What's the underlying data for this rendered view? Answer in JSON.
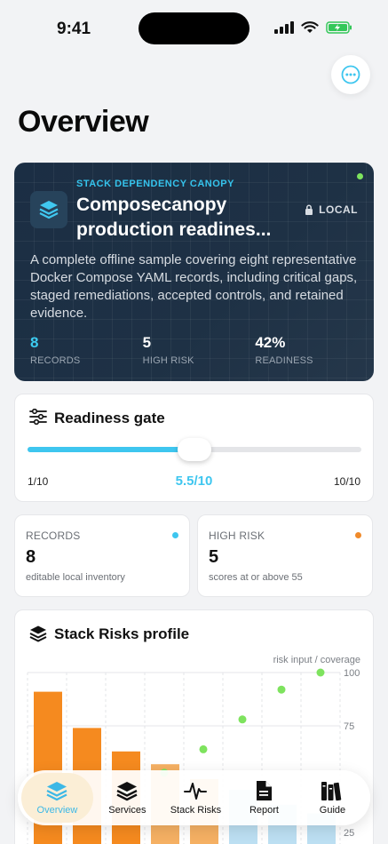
{
  "status": {
    "time": "9:41"
  },
  "page": {
    "title": "Overview"
  },
  "hero": {
    "kicker": "STACK DEPENDENCY CANOPY",
    "title": "Composecanopy production readines...",
    "badge": "LOCAL",
    "description": "A complete offline sample covering eight representative Docker Compose YAML records, including critical gaps, staged remediations, accepted controls, and retained evidence.",
    "stats": [
      {
        "value": "8",
        "label": "RECORDS"
      },
      {
        "value": "5",
        "label": "HIGH RISK"
      },
      {
        "value": "42%",
        "label": "READINESS"
      }
    ]
  },
  "gate": {
    "title": "Readiness gate",
    "min_label": "1/10",
    "max_label": "10/10",
    "value_label": "5.5/10",
    "value": 5.5,
    "min": 1,
    "max": 10
  },
  "cards": [
    {
      "label": "RECORDS",
      "value": "8",
      "sub": "editable local inventory",
      "dot_color": "#3ec6ef"
    },
    {
      "label": "HIGH RISK",
      "value": "5",
      "sub": "scores at or above 55",
      "dot_color": "#f08a2a"
    }
  ],
  "profile": {
    "title": "Stack Risks profile",
    "caption": "risk input / coverage"
  },
  "chart_data": {
    "type": "bar",
    "right_axis_ticks": [
      "100",
      "75",
      "25"
    ],
    "ylim": [
      0,
      100
    ],
    "bars": [
      91,
      74,
      63,
      57,
      50,
      45,
      38,
      34
    ],
    "bar_colors": [
      "#f58a1f",
      "#f58a1f",
      "#f58a1f",
      "#f5b063",
      "#f5b063",
      "#bcdff2",
      "#bcdff2",
      "#bcdff2"
    ],
    "points": [
      32,
      36,
      44,
      53,
      64,
      78,
      92,
      100
    ],
    "point_color": "#7ee35e"
  },
  "tabs": [
    {
      "label": "Overview",
      "icon": "layers-icon",
      "active": true
    },
    {
      "label": "Services",
      "icon": "stack-icon",
      "active": false
    },
    {
      "label": "Stack Risks",
      "icon": "pulse-icon",
      "active": false
    },
    {
      "label": "Report",
      "icon": "document-icon",
      "active": false
    },
    {
      "label": "Guide",
      "icon": "books-icon",
      "active": false
    }
  ],
  "colors": {
    "accent": "#3ec6ef",
    "orange": "#f08a2a",
    "green": "#7ee35e"
  }
}
